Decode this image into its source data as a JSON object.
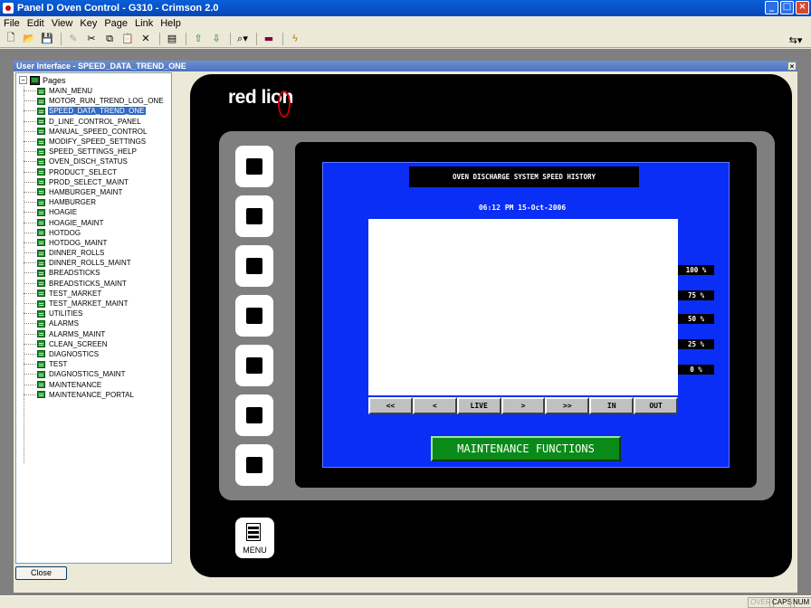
{
  "app": {
    "title": "Panel D Oven Control - G310 - Crimson 2.0"
  },
  "menu": [
    "File",
    "Edit",
    "View",
    "Key",
    "Page",
    "Link",
    "Help"
  ],
  "child_window": {
    "title": "User Interface - SPEED_DATA_TREND_ONE",
    "close_label": "Close"
  },
  "tree": {
    "root": "Pages",
    "items": [
      "MAIN_MENU",
      "MOTOR_RUN_TREND_LOG_ONE",
      "SPEED_DATA_TREND_ONE",
      "D_LINE_CONTROL_PANEL",
      "MANUAL_SPEED_CONTROL",
      "MODIFY_SPEED_SETTINGS",
      "SPEED_SETTINGS_HELP",
      "OVEN_DISCH_STATUS",
      "PRODUCT_SELECT",
      "PROD_SELECT_MAINT",
      "HAMBURGER_MAINT",
      "HAMBURGER",
      "HOAGIE",
      "HOAGIE_MAINT",
      "HOTDOG",
      "HOTDOG_MAINT",
      "DINNER_ROLLS",
      "DINNER_ROLLS_MAINT",
      "BREADSTICKS",
      "BREADSTICKS_MAINT",
      "TEST_MARKET",
      "TEST_MARKET_MAINT",
      "UTILITIES",
      "ALARMS",
      "ALARMS_MAINT",
      "CLEAN_SCREEN",
      "DIAGNOSTICS",
      "TEST",
      "DIAGNOSTICS_MAINT",
      "MAINTENANCE",
      "MAINTENANCE_PORTAL"
    ],
    "selected": "SPEED_DATA_TREND_ONE"
  },
  "device": {
    "brand": "red lion",
    "screen_title": "OVEN DISCHARGE SYSTEM SPEED HISTORY",
    "timestamp": "06:12 PM 15-Oct-2006",
    "scale_labels": [
      "100 %",
      "75 %",
      "50 %",
      "25 %",
      "0 %"
    ],
    "nav_buttons": [
      "<<",
      "<",
      "LIVE",
      ">",
      ">>",
      "IN",
      "OUT"
    ],
    "maintenance_button": "MAINTENANCE FUNCTIONS",
    "menu_key_label": "MENU"
  },
  "status": {
    "over": "OVER",
    "caps": "CAPS",
    "num": "NUM"
  },
  "colors": {
    "screen_bg": "#0a2ef6",
    "maint_green": "#0a8a18",
    "selection": "#316ac5"
  }
}
